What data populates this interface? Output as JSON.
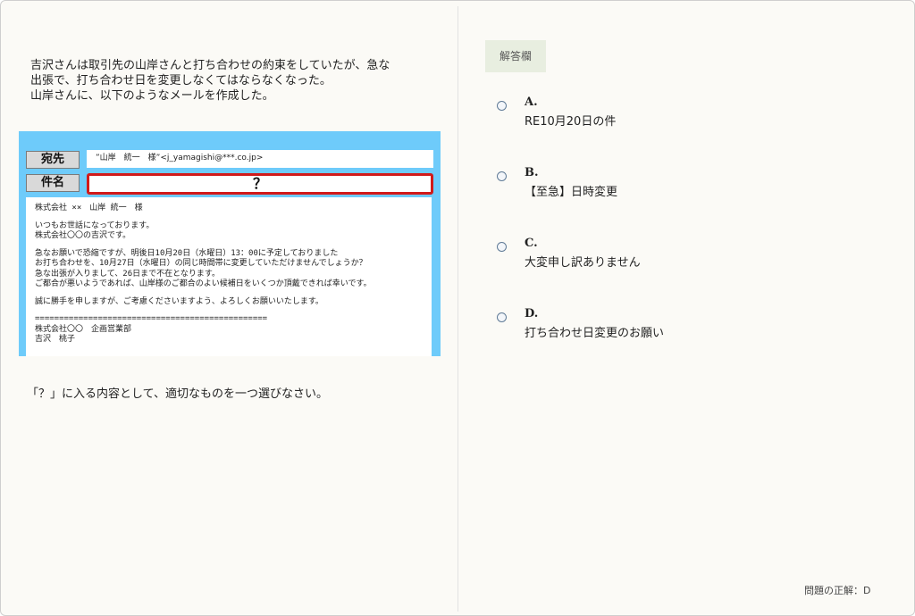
{
  "question": {
    "lines": [
      "吉沢さんは取引先の山岸さんと打ち合わせの約束をしていたが、急な",
      "出張で、打ち合わせ日を変更しなくてはならなくなった。",
      "山岸さんに、以下のようなメールを作成した。"
    ]
  },
  "email": {
    "to_label": "宛先",
    "to_value": "”山岸　統一　様”<j_yamagishi@***.co.jp>",
    "subject_label": "件名",
    "subject_value": "？",
    "body": [
      "株式会社 ××　山岸 統一　様",
      "",
      "いつもお世話になっております。",
      "株式会社〇〇の吉沢です。",
      "",
      "急なお願いで恐縮ですが、明後日10月20日（水曜日）13：00に予定しておりました",
      "お打ち合わせを、10月27日（水曜日）の同じ時間帯に変更していただけませんでしょうか？",
      "急な出張が入りまして、26日まで不在となります。",
      "ご都合が悪いようであれば、山岸様のご都合のよい候補日をいくつか頂戴できれば幸いです。",
      "",
      "誠に勝手を申しますが、ご考慮くださいますよう、よろしくお願いいたします。",
      "",
      "================================================",
      "株式会社〇〇　企画営業部",
      "吉沢　桃子"
    ]
  },
  "instruction": "「？」に入る内容として、適切なものを一つ選びなさい。",
  "answer_panel": {
    "label": "解答欄",
    "options": [
      {
        "letter": "A.",
        "text": "RE10月20日の件"
      },
      {
        "letter": "B.",
        "text": "【至急】日時変更"
      },
      {
        "letter": "C.",
        "text": "大変申し訳ありません"
      },
      {
        "letter": "D.",
        "text": "打ち合わせ日変更のお願い"
      }
    ]
  },
  "correct_answer": "問題の正解：D"
}
